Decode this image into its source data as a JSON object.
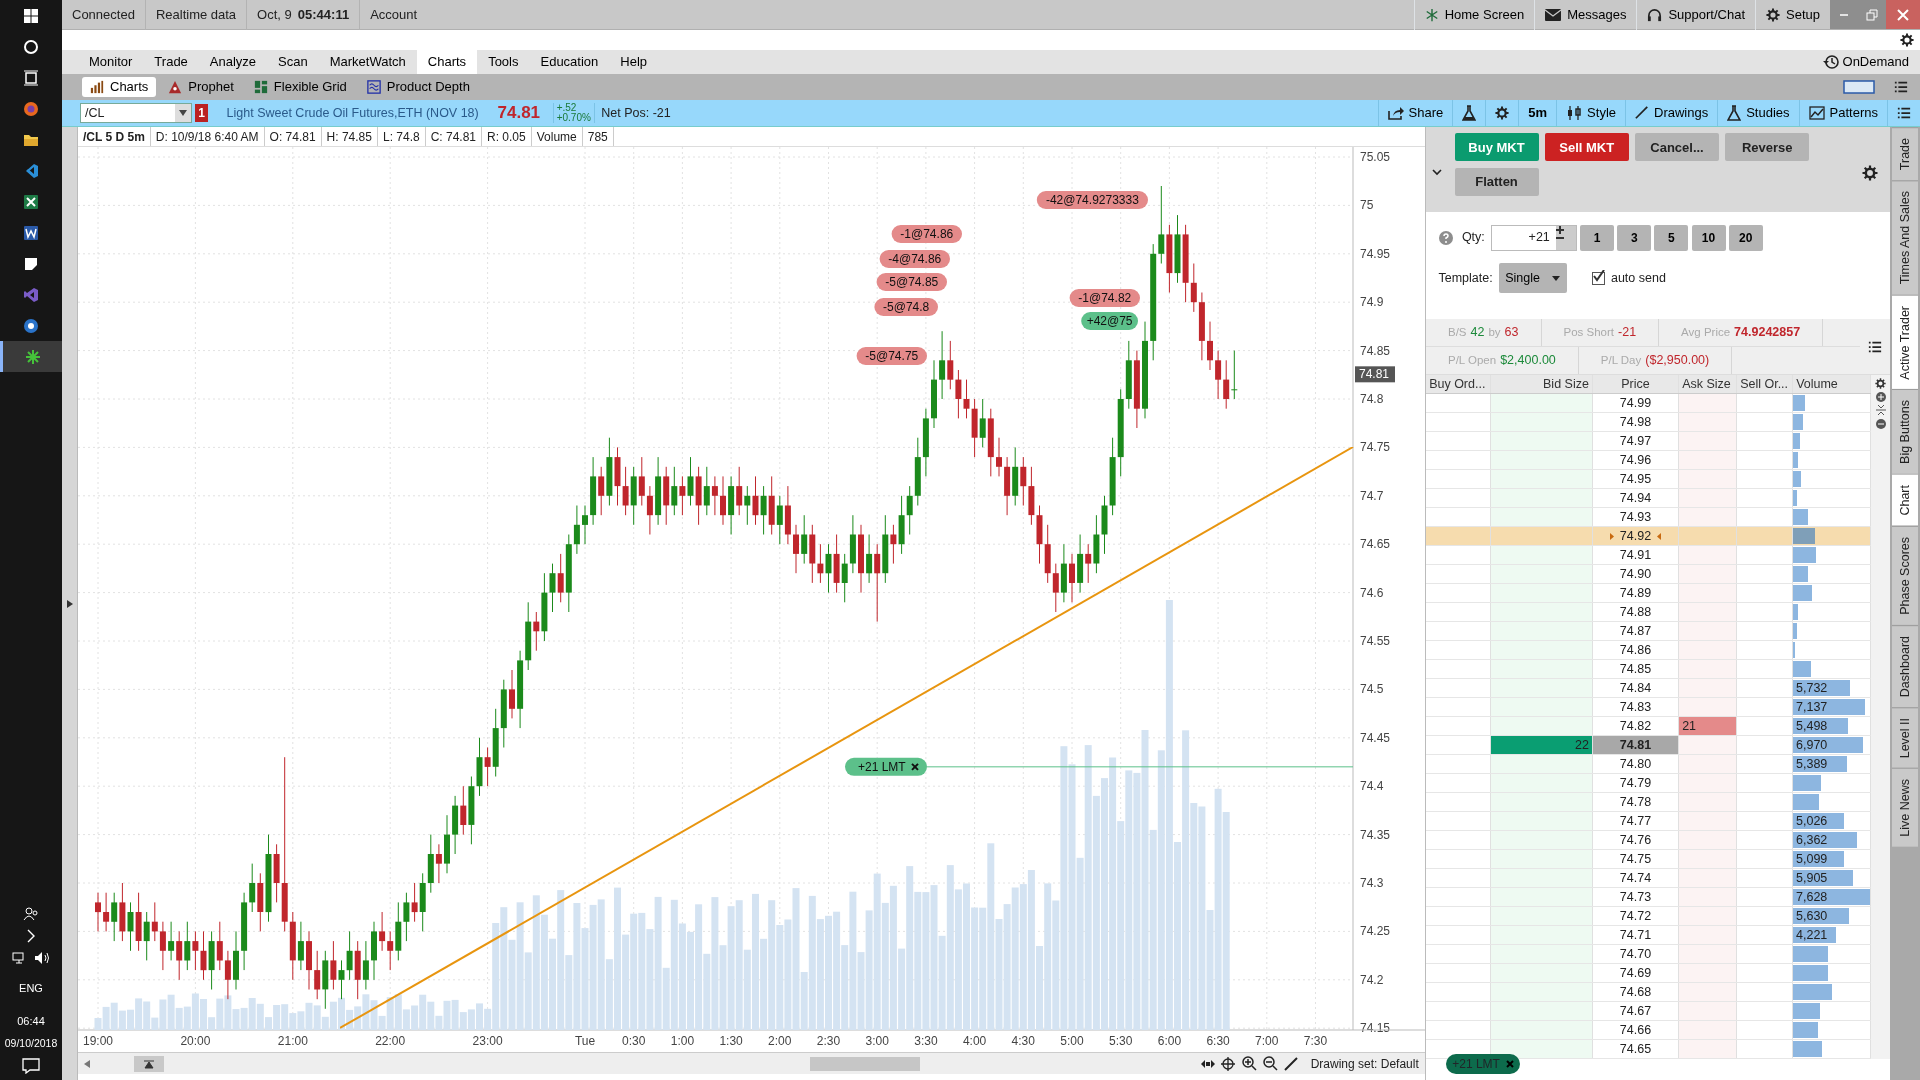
{
  "taskbar": {
    "apps": [
      {
        "kind": "start",
        "active": false
      },
      {
        "kind": "search",
        "active": false
      },
      {
        "kind": "taskview",
        "active": false
      },
      {
        "kind": "firefox",
        "active": false
      },
      {
        "kind": "folder",
        "active": false
      },
      {
        "kind": "vscode",
        "active": false
      },
      {
        "kind": "excel",
        "active": false
      },
      {
        "kind": "word",
        "active": false
      },
      {
        "kind": "notes",
        "active": false
      },
      {
        "kind": "vs",
        "active": false
      },
      {
        "kind": "r",
        "active": false
      },
      {
        "kind": "tos",
        "active": true
      }
    ],
    "language": "ENG",
    "time": "06:44",
    "date": "09/10/2018"
  },
  "status_bar": {
    "connection": "Connected",
    "data_feed": "Realtime data",
    "date": "Oct, 9",
    "time": "05:44:11",
    "account_label": "Account",
    "links": [
      {
        "kind": "home",
        "label": "Home Screen"
      },
      {
        "kind": "mail",
        "label": "Messages"
      },
      {
        "kind": "headset",
        "label": "Support/Chat"
      },
      {
        "kind": "gear",
        "label": "Setup"
      }
    ]
  },
  "menu_tabs": [
    {
      "label": "Monitor",
      "selected": false
    },
    {
      "label": "Trade",
      "selected": false
    },
    {
      "label": "Analyze",
      "selected": false
    },
    {
      "label": "Scan",
      "selected": false
    },
    {
      "label": "MarketWatch",
      "selected": false
    },
    {
      "label": "Charts",
      "selected": true
    },
    {
      "label": "Tools",
      "selected": false
    },
    {
      "label": "Education",
      "selected": false
    },
    {
      "label": "Help",
      "selected": false
    }
  ],
  "on_demand": "OnDemand",
  "sub_tabs": [
    {
      "kind": "charts",
      "label": "Charts",
      "selected": true
    },
    {
      "kind": "prophet",
      "label": "Prophet",
      "selected": false
    },
    {
      "kind": "grid",
      "label": "Flexible Grid",
      "selected": false
    },
    {
      "kind": "depth",
      "label": "Product Depth",
      "selected": false
    }
  ],
  "symbol_bar": {
    "symbol": "/CL",
    "alert_count": "1",
    "description": "Light Sweet Crude Oil Futures,ETH (NOV 18)",
    "last": "74.81",
    "change": "+.52",
    "change_pct": "+0.70%",
    "net_pos": "Net Pos: -21",
    "tools": [
      {
        "kind": "share",
        "label": "Share"
      },
      {
        "kind": "flask"
      },
      {
        "kind": "gear"
      },
      {
        "kind": "text",
        "label": "5m"
      },
      {
        "kind": "style",
        "label": "Style"
      },
      {
        "kind": "drawings",
        "label": "Drawings"
      },
      {
        "kind": "studies",
        "label": "Studies"
      },
      {
        "kind": "patterns",
        "label": "Patterns"
      },
      {
        "kind": "menu"
      }
    ]
  },
  "chart": {
    "info": [
      "/CL 5 D 5m",
      "D: 10/9/18 6:40 AM",
      "O: 74.81",
      "H: 74.85",
      "L: 74.8",
      "C: 74.81",
      "R: 0.05",
      "Volume",
      "785"
    ],
    "last_price_tag": "74.81",
    "chart_data": {
      "type": "candlestick",
      "ylim": [
        74.15,
        75.05
      ],
      "grid": true,
      "ref_lines": [
        {
          "axis": "y",
          "value": 74.42,
          "color": "#5cc08a"
        }
      ],
      "yticks": [
        75.05,
        75,
        74.95,
        74.9,
        74.85,
        74.8,
        74.75,
        74.7,
        74.65,
        74.6,
        74.55,
        74.5,
        74.45,
        74.4,
        74.35,
        74.3,
        74.25,
        74.2,
        74.15
      ],
      "categories": [
        "19:00",
        null,
        null,
        null,
        null,
        null,
        null,
        null,
        null,
        null,
        null,
        null,
        "20:00",
        null,
        null,
        null,
        null,
        null,
        null,
        null,
        null,
        null,
        null,
        null,
        "21:00",
        null,
        null,
        null,
        null,
        null,
        null,
        null,
        null,
        null,
        null,
        null,
        "22:00",
        null,
        null,
        null,
        null,
        null,
        null,
        null,
        null,
        null,
        null,
        null,
        "23:00",
        null,
        null,
        null,
        null,
        null,
        null,
        null,
        null,
        null,
        null,
        null,
        "Tue",
        null,
        null,
        null,
        null,
        null,
        "0:30",
        null,
        null,
        null,
        null,
        null,
        "1:00",
        null,
        null,
        null,
        null,
        null,
        "1:30",
        null,
        null,
        null,
        null,
        null,
        "2:00",
        null,
        null,
        null,
        null,
        null,
        "2:30",
        null,
        null,
        null,
        null,
        null,
        "3:00",
        null,
        null,
        null,
        null,
        null,
        "3:30",
        null,
        null,
        null,
        null,
        null,
        "4:00",
        null,
        null,
        null,
        null,
        null,
        "4:30",
        null,
        null,
        null,
        null,
        null,
        "5:00",
        null,
        null,
        null,
        null,
        null,
        "5:30",
        null,
        null,
        null,
        null,
        null,
        "6:00",
        null,
        null,
        null,
        null,
        null,
        "6:30",
        null,
        null,
        null,
        null,
        null,
        "7:00",
        null,
        null,
        null,
        null,
        null,
        "7:30"
      ],
      "ohlc": [
        [
          74.28,
          74.29,
          74.25,
          74.27
        ],
        [
          74.27,
          74.29,
          74.25,
          74.26
        ],
        [
          74.26,
          74.29,
          74.24,
          74.28
        ],
        [
          74.28,
          74.3,
          74.24,
          74.25
        ],
        [
          74.25,
          74.28,
          74.23,
          74.27
        ],
        [
          74.27,
          74.29,
          74.23,
          74.24
        ],
        [
          74.24,
          74.27,
          74.22,
          74.26
        ],
        [
          74.26,
          74.28,
          74.24,
          74.25
        ],
        [
          74.25,
          74.26,
          74.21,
          74.23
        ],
        [
          74.23,
          74.26,
          74.22,
          74.24
        ],
        [
          74.24,
          74.25,
          74.2,
          74.22
        ],
        [
          74.22,
          74.26,
          74.21,
          74.24
        ],
        [
          74.24,
          74.25,
          74.21,
          74.23
        ],
        [
          74.23,
          74.25,
          74.2,
          74.21
        ],
        [
          74.21,
          74.25,
          74.19,
          74.24
        ],
        [
          74.24,
          74.26,
          74.21,
          74.22
        ],
        [
          74.22,
          74.23,
          74.18,
          74.2
        ],
        [
          74.2,
          74.25,
          74.19,
          74.23
        ],
        [
          74.23,
          74.29,
          74.21,
          74.28
        ],
        [
          74.28,
          74.32,
          74.27,
          74.3
        ],
        [
          74.3,
          74.31,
          74.25,
          74.27
        ],
        [
          74.27,
          74.35,
          74.26,
          74.33
        ],
        [
          74.33,
          74.34,
          74.28,
          74.3
        ],
        [
          74.3,
          74.43,
          74.25,
          74.26
        ],
        [
          74.26,
          74.27,
          74.2,
          74.22
        ],
        [
          74.22,
          74.26,
          74.21,
          74.24
        ],
        [
          74.24,
          74.25,
          74.19,
          74.21
        ],
        [
          74.21,
          74.23,
          74.18,
          74.19
        ],
        [
          74.19,
          74.23,
          74.17,
          74.22
        ],
        [
          74.22,
          74.24,
          74.19,
          74.2
        ],
        [
          74.2,
          74.22,
          74.18,
          74.21
        ],
        [
          74.21,
          74.25,
          74.2,
          74.23
        ],
        [
          74.23,
          74.24,
          74.18,
          74.2
        ],
        [
          74.2,
          74.24,
          74.19,
          74.22
        ],
        [
          74.22,
          74.26,
          74.2,
          74.25
        ],
        [
          74.25,
          74.27,
          74.23,
          74.24
        ],
        [
          74.24,
          74.25,
          74.21,
          74.23
        ],
        [
          74.23,
          74.28,
          74.22,
          74.26
        ],
        [
          74.26,
          74.29,
          74.24,
          74.28
        ],
        [
          74.28,
          74.3,
          74.26,
          74.27
        ],
        [
          74.27,
          74.31,
          74.25,
          74.3
        ],
        [
          74.3,
          74.35,
          74.29,
          74.33
        ],
        [
          74.33,
          74.34,
          74.3,
          74.32
        ],
        [
          74.32,
          74.37,
          74.31,
          74.35
        ],
        [
          74.35,
          74.39,
          74.33,
          74.38
        ],
        [
          74.38,
          74.4,
          74.35,
          74.36
        ],
        [
          74.36,
          74.41,
          74.34,
          74.4
        ],
        [
          74.4,
          74.45,
          74.39,
          74.43
        ],
        [
          74.43,
          74.44,
          74.4,
          74.42
        ],
        [
          74.42,
          74.48,
          74.41,
          74.46
        ],
        [
          74.46,
          74.51,
          74.44,
          74.5
        ],
        [
          74.5,
          74.52,
          74.47,
          74.48
        ],
        [
          74.48,
          74.54,
          74.46,
          74.53
        ],
        [
          74.53,
          74.59,
          74.52,
          74.57
        ],
        [
          74.57,
          74.58,
          74.54,
          74.56
        ],
        [
          74.56,
          74.62,
          74.55,
          74.6
        ],
        [
          74.6,
          74.63,
          74.58,
          74.62
        ],
        [
          74.62,
          74.64,
          74.59,
          74.6
        ],
        [
          74.6,
          74.66,
          74.58,
          74.65
        ],
        [
          74.65,
          74.69,
          74.64,
          74.67
        ],
        [
          74.67,
          74.69,
          74.65,
          74.68
        ],
        [
          74.68,
          74.74,
          74.67,
          74.72
        ],
        [
          74.72,
          74.73,
          74.68,
          74.7
        ],
        [
          74.7,
          74.76,
          74.69,
          74.74
        ],
        [
          74.74,
          74.75,
          74.69,
          74.71
        ],
        [
          74.71,
          74.73,
          74.68,
          74.69
        ],
        [
          74.69,
          74.73,
          74.67,
          74.72
        ],
        [
          74.72,
          74.74,
          74.69,
          74.7
        ],
        [
          74.7,
          74.71,
          74.66,
          74.68
        ],
        [
          74.68,
          74.74,
          74.67,
          74.72
        ],
        [
          74.72,
          74.73,
          74.67,
          74.69
        ],
        [
          74.69,
          74.73,
          74.68,
          74.71
        ],
        [
          74.71,
          74.72,
          74.68,
          74.7
        ],
        [
          74.7,
          74.74,
          74.69,
          74.72
        ],
        [
          74.72,
          74.73,
          74.67,
          74.69
        ],
        [
          74.69,
          74.73,
          74.68,
          74.71
        ],
        [
          74.71,
          74.72,
          74.68,
          74.7
        ],
        [
          74.7,
          74.72,
          74.67,
          74.68
        ],
        [
          74.68,
          74.72,
          74.66,
          74.71
        ],
        [
          74.71,
          74.73,
          74.68,
          74.69
        ],
        [
          74.69,
          74.71,
          74.67,
          74.7
        ],
        [
          74.7,
          74.72,
          74.67,
          74.68
        ],
        [
          74.68,
          74.71,
          74.66,
          74.7
        ],
        [
          74.7,
          74.72,
          74.66,
          74.67
        ],
        [
          74.67,
          74.7,
          74.65,
          74.69
        ],
        [
          74.69,
          74.71,
          74.65,
          74.66
        ],
        [
          74.66,
          74.67,
          74.62,
          74.64
        ],
        [
          74.64,
          74.68,
          74.63,
          74.66
        ],
        [
          74.66,
          74.67,
          74.61,
          74.63
        ],
        [
          74.63,
          74.65,
          74.61,
          74.62
        ],
        [
          74.62,
          74.65,
          74.6,
          74.64
        ],
        [
          74.64,
          74.66,
          74.6,
          74.61
        ],
        [
          74.61,
          74.64,
          74.59,
          74.63
        ],
        [
          74.63,
          74.68,
          74.62,
          74.66
        ],
        [
          74.66,
          74.67,
          74.6,
          74.62
        ],
        [
          74.62,
          74.66,
          74.61,
          74.64
        ],
        [
          74.64,
          74.65,
          74.57,
          74.62
        ],
        [
          74.62,
          74.68,
          74.61,
          74.66
        ],
        [
          74.66,
          74.67,
          74.63,
          74.65
        ],
        [
          74.65,
          74.7,
          74.64,
          74.68
        ],
        [
          74.68,
          74.71,
          74.66,
          74.7
        ],
        [
          74.7,
          74.76,
          74.69,
          74.74
        ],
        [
          74.74,
          74.79,
          74.72,
          74.78
        ],
        [
          74.78,
          74.84,
          74.77,
          74.82
        ],
        [
          74.82,
          74.87,
          74.8,
          74.84
        ],
        [
          74.84,
          74.86,
          74.81,
          74.82
        ],
        [
          74.82,
          74.83,
          74.78,
          74.8
        ],
        [
          74.8,
          74.82,
          74.78,
          74.79
        ],
        [
          74.79,
          74.8,
          74.74,
          74.76
        ],
        [
          74.76,
          74.8,
          74.75,
          74.78
        ],
        [
          74.78,
          74.79,
          74.72,
          74.74
        ],
        [
          74.74,
          74.76,
          74.72,
          74.73
        ],
        [
          74.73,
          74.74,
          74.68,
          74.7
        ],
        [
          74.7,
          74.75,
          74.69,
          74.73
        ],
        [
          74.73,
          74.74,
          74.69,
          74.71
        ],
        [
          74.71,
          74.73,
          74.67,
          74.68
        ],
        [
          74.68,
          74.69,
          74.63,
          74.65
        ],
        [
          74.65,
          74.67,
          74.61,
          74.62
        ],
        [
          74.62,
          74.63,
          74.58,
          74.6
        ],
        [
          74.6,
          74.65,
          74.59,
          74.63
        ],
        [
          74.63,
          74.64,
          74.59,
          74.61
        ],
        [
          74.61,
          74.66,
          74.6,
          74.64
        ],
        [
          74.64,
          74.65,
          74.61,
          74.63
        ],
        [
          74.63,
          74.68,
          74.62,
          74.66
        ],
        [
          74.66,
          74.7,
          74.64,
          74.69
        ],
        [
          74.69,
          74.76,
          74.68,
          74.74
        ],
        [
          74.74,
          74.81,
          74.72,
          74.8
        ],
        [
          74.8,
          74.86,
          74.79,
          74.84
        ],
        [
          74.84,
          74.85,
          74.77,
          74.79
        ],
        [
          74.79,
          74.88,
          74.78,
          74.86
        ],
        [
          74.86,
          74.96,
          74.84,
          74.95
        ],
        [
          74.95,
          75.02,
          74.94,
          74.97
        ],
        [
          74.97,
          74.98,
          74.91,
          74.93
        ],
        [
          74.93,
          74.99,
          74.92,
          74.97
        ],
        [
          74.97,
          74.98,
          74.9,
          74.92
        ],
        [
          74.92,
          74.94,
          74.89,
          74.9
        ],
        [
          74.9,
          74.91,
          74.84,
          74.86
        ],
        [
          74.86,
          74.88,
          74.83,
          74.84
        ],
        [
          74.84,
          74.85,
          74.8,
          74.82
        ],
        [
          74.82,
          74.84,
          74.79,
          74.8
        ],
        [
          74.81,
          74.85,
          74.8,
          74.81
        ],
        null,
        null,
        null,
        null,
        null,
        null,
        null,
        null,
        null,
        null
      ]
    },
    "trades": [
      {
        "label": "-1@74.86",
        "kind": "sell"
      },
      {
        "label": "-4@74.86",
        "kind": "sell"
      },
      {
        "label": "-5@74.85",
        "kind": "sell"
      },
      {
        "label": "-5@74.8",
        "kind": "sell"
      },
      {
        "label": "-5@74.75",
        "kind": "sell"
      },
      {
        "label": "-42@74.9273333",
        "kind": "sell"
      },
      {
        "label": "-1@74.82",
        "kind": "sell"
      },
      {
        "label": "+42@75",
        "kind": "buy"
      }
    ],
    "order_tag": "+21 LMT",
    "drawing_set": "Drawing set: Default"
  },
  "active_trader": {
    "buttons": [
      {
        "label": "Buy MKT",
        "kind": "buy"
      },
      {
        "label": "Sell MKT",
        "kind": "sell"
      },
      {
        "label": "Cancel...",
        "kind": "plain"
      },
      {
        "label": "Reverse",
        "kind": "plain"
      },
      {
        "label": "Flatten",
        "kind": "plain"
      }
    ],
    "qty_label": "Qty:",
    "qty": "+21",
    "qty_presets": [
      "1",
      "3",
      "5",
      "10",
      "20"
    ],
    "template_label": "Template:",
    "template": "Single",
    "auto_send": {
      "label": "auto send",
      "checked": true
    },
    "stats": [
      [
        [
          {
            "text": "B/S",
            "kind": "label"
          },
          {
            "text": "42",
            "kind": "positive"
          },
          {
            "text": "by",
            "kind": "label"
          },
          {
            "text": "63",
            "kind": "negative"
          }
        ],
        [
          {
            "text": "Pos Short",
            "kind": "label"
          },
          {
            "text": "-21",
            "kind": "negative"
          }
        ],
        [
          {
            "text": "Avg Price",
            "kind": "label"
          },
          {
            "text": "74.9242857",
            "kind": "strong"
          }
        ]
      ],
      [
        [
          {
            "text": "P/L Open",
            "kind": "label"
          },
          {
            "text": "$2,400.00",
            "kind": "positive"
          }
        ],
        [
          {
            "text": "P/L Day",
            "kind": "label"
          },
          {
            "text": "($2,950.00)",
            "kind": "negative"
          }
        ]
      ]
    ],
    "columns": [
      "Buy Ord...",
      "Bid Size",
      "Price",
      "Ask Size",
      "Sell Or...",
      "Volume"
    ],
    "rows": [
      {
        "price": "74.99",
        "level": 0.15,
        "highlighted": false,
        "last": false
      },
      {
        "price": "74.98",
        "level": 0.13,
        "highlighted": false,
        "last": false
      },
      {
        "price": "74.97",
        "level": 0.09,
        "highlighted": false,
        "last": false
      },
      {
        "price": "74.96",
        "level": 0.07,
        "highlighted": false,
        "last": false
      },
      {
        "price": "74.95",
        "level": 0.1,
        "highlighted": false,
        "last": false
      },
      {
        "price": "74.94",
        "level": 0.05,
        "highlighted": false,
        "last": false
      },
      {
        "price": "74.93",
        "level": 0.19,
        "highlighted": false,
        "last": false
      },
      {
        "price": "74.92",
        "level": 0.28,
        "highlighted": true,
        "last": false
      },
      {
        "price": "74.91",
        "level": 0.3,
        "highlighted": false,
        "last": false
      },
      {
        "price": "74.90",
        "level": 0.19,
        "highlighted": false,
        "last": false
      },
      {
        "price": "74.89",
        "level": 0.25,
        "highlighted": false,
        "last": false
      },
      {
        "price": "74.88",
        "level": 0.07,
        "highlighted": false,
        "last": false
      },
      {
        "price": "74.87",
        "level": 0.05,
        "highlighted": false,
        "last": false
      },
      {
        "price": "74.86",
        "level": 0.03,
        "highlighted": false,
        "last": false
      },
      {
        "price": "74.85",
        "level": 0.23,
        "highlighted": false,
        "last": false
      },
      {
        "price": "74.84",
        "level": 0.74,
        "volume": "5,732",
        "highlighted": false,
        "last": false
      },
      {
        "price": "74.83",
        "level": 0.93,
        "volume": "7,137",
        "highlighted": false,
        "last": false
      },
      {
        "price": "74.82",
        "level": 0.71,
        "volume": "5,498",
        "ask_size": "21",
        "highlighted": false,
        "last": false
      },
      {
        "price": "74.81",
        "level": 0.91,
        "volume": "6,970",
        "bid_size": "22",
        "highlighted": false,
        "last": true
      },
      {
        "price": "74.80",
        "level": 0.7,
        "volume": "5,389",
        "highlighted": false,
        "last": false
      },
      {
        "price": "74.79",
        "level": 0.37,
        "highlighted": false,
        "last": false
      },
      {
        "price": "74.78",
        "level": 0.34,
        "highlighted": false,
        "last": false
      },
      {
        "price": "74.77",
        "level": 0.66,
        "volume": "5,026",
        "highlighted": false,
        "last": false
      },
      {
        "price": "74.76",
        "level": 0.83,
        "volume": "6,362",
        "highlighted": false,
        "last": false
      },
      {
        "price": "74.75",
        "level": 0.66,
        "volume": "5,099",
        "highlighted": false,
        "last": false
      },
      {
        "price": "74.74",
        "level": 0.78,
        "volume": "5,905",
        "highlighted": false,
        "last": false
      },
      {
        "price": "74.73",
        "level": 1.0,
        "volume": "7,628",
        "highlighted": false,
        "last": false
      },
      {
        "price": "74.72",
        "level": 0.73,
        "volume": "5,630",
        "highlighted": false,
        "last": false
      },
      {
        "price": "74.71",
        "level": 0.56,
        "volume": "4,221",
        "highlighted": false,
        "last": false
      },
      {
        "price": "74.70",
        "level": 0.46,
        "highlighted": false,
        "last": false
      },
      {
        "price": "74.69",
        "level": 0.45,
        "highlighted": false,
        "last": false
      },
      {
        "price": "74.68",
        "level": 0.5,
        "highlighted": false,
        "last": false
      },
      {
        "price": "74.67",
        "level": 0.35,
        "highlighted": false,
        "last": false
      },
      {
        "price": "74.66",
        "level": 0.33,
        "highlighted": false,
        "last": false
      },
      {
        "price": "74.65",
        "level": 0.38,
        "highlighted": false,
        "last": false
      }
    ],
    "order_tag": "+21 LMT"
  },
  "side_tabs": [
    {
      "label": "Trade",
      "selected": false
    },
    {
      "label": "Times And Sales",
      "selected": false
    },
    {
      "label": "Active Trader",
      "selected": true
    },
    {
      "label": "Big Buttons",
      "selected": false
    },
    {
      "label": "Chart",
      "selected": true
    },
    {
      "label": "Phase Scores",
      "selected": false
    },
    {
      "label": "Dashboard",
      "selected": false
    },
    {
      "label": "Level II",
      "selected": false
    },
    {
      "label": "Live News",
      "selected": false
    }
  ]
}
